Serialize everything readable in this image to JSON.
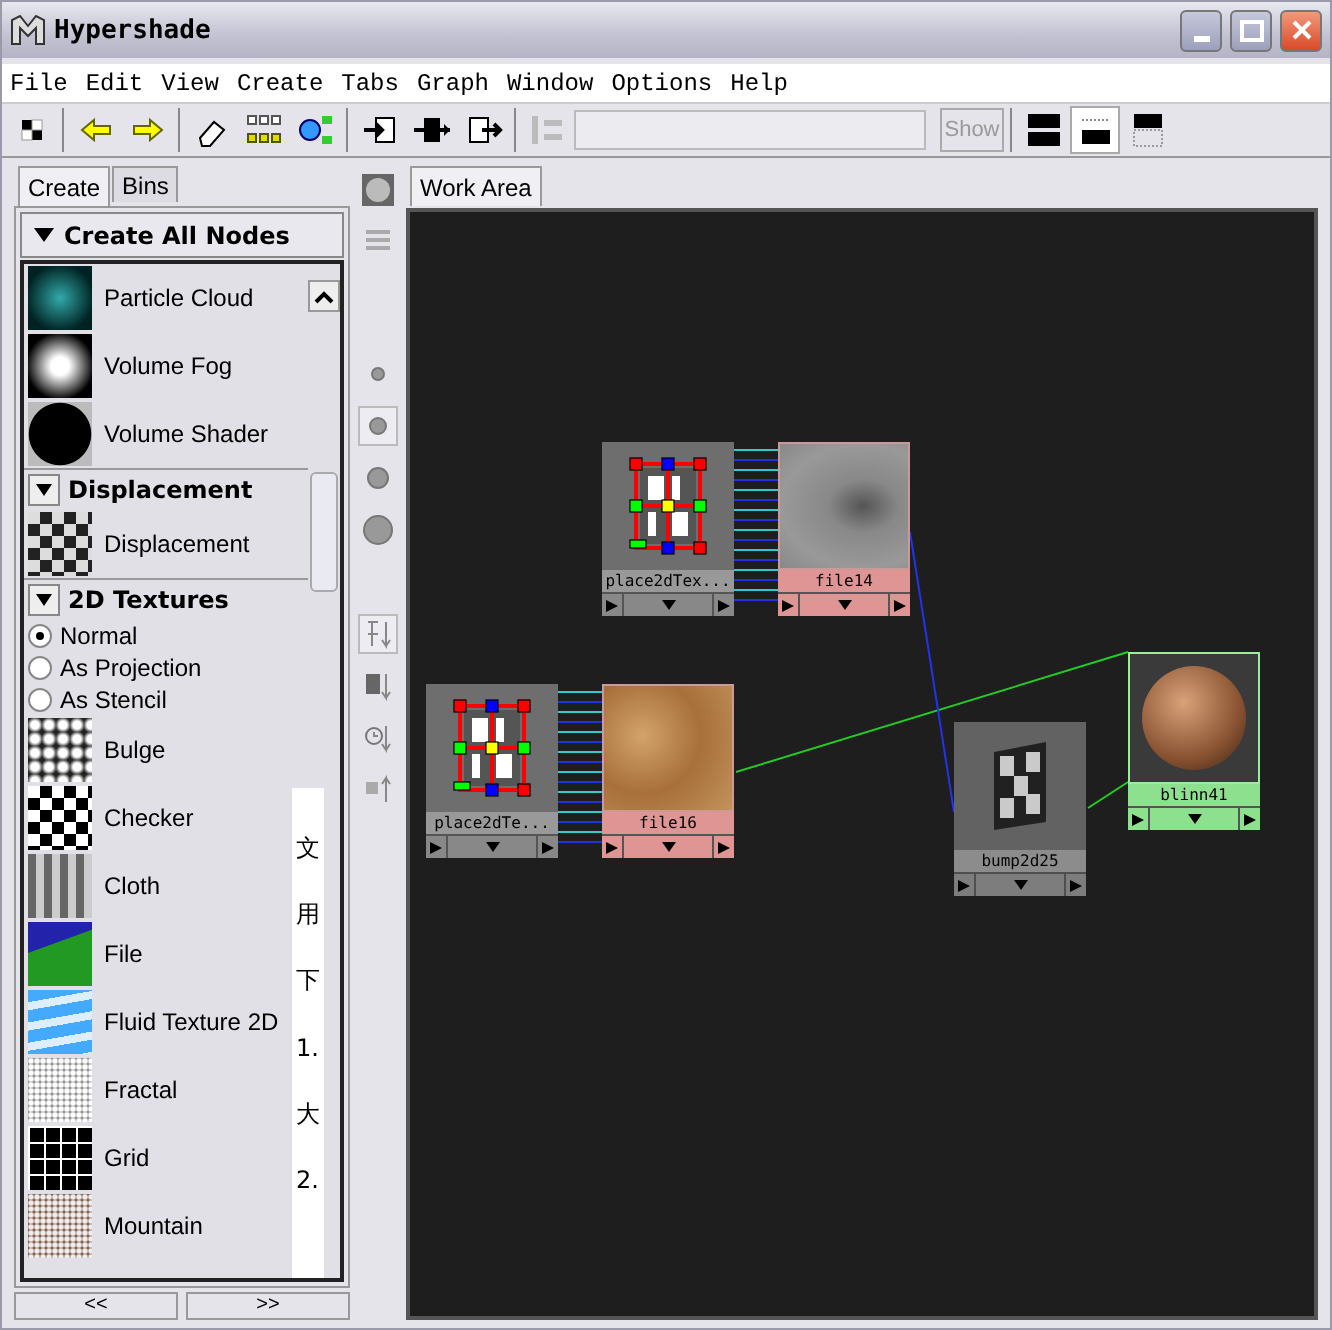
{
  "window": {
    "title": "Hypershade"
  },
  "menu": [
    "File",
    "Edit",
    "View",
    "Create",
    "Tabs",
    "Graph",
    "Window",
    "Options",
    "Help"
  ],
  "toolbar": {
    "show_button": "Show"
  },
  "tabs": [
    {
      "label": "Create",
      "selected": true
    },
    {
      "label": "Bins",
      "selected": false
    }
  ],
  "panel": {
    "header": "Create All Nodes",
    "entries": [
      {
        "kind": "item",
        "label": "Particle Cloud"
      },
      {
        "kind": "item",
        "label": "Volume Fog"
      },
      {
        "kind": "item",
        "label": "Volume Shader"
      },
      {
        "kind": "section",
        "label": "Displacement",
        "expanded": true
      },
      {
        "kind": "item",
        "label": "Displacement"
      },
      {
        "kind": "section",
        "label": "2D Textures",
        "expanded": true
      },
      {
        "kind": "radio",
        "label": "Normal",
        "selected": true
      },
      {
        "kind": "radio",
        "label": "As Projection",
        "selected": false
      },
      {
        "kind": "radio",
        "label": "As Stencil",
        "selected": false
      },
      {
        "kind": "item",
        "label": "Bulge"
      },
      {
        "kind": "item",
        "label": "Checker"
      },
      {
        "kind": "item",
        "label": "Cloth"
      },
      {
        "kind": "item",
        "label": "File"
      },
      {
        "kind": "item",
        "label": "Fluid Texture 2D"
      },
      {
        "kind": "item",
        "label": "Fractal"
      },
      {
        "kind": "item",
        "label": "Grid"
      },
      {
        "kind": "item",
        "label": "Mountain"
      }
    ],
    "behind_fragments": [
      "文",
      "用",
      "下",
      "1.",
      "大",
      "2."
    ],
    "pager": [
      "<<",
      ">>"
    ]
  },
  "work_tab": {
    "label": "Work Area",
    "selected": true
  },
  "graph": {
    "nodes": [
      {
        "label": "place2dTex...",
        "kind": "place2d"
      },
      {
        "label": "file14",
        "kind": "file"
      },
      {
        "label": "place2dTe...",
        "kind": "place2d"
      },
      {
        "label": "file16",
        "kind": "file"
      },
      {
        "label": "bump2d25",
        "kind": "bump"
      },
      {
        "label": "blinn41",
        "kind": "material"
      }
    ]
  }
}
